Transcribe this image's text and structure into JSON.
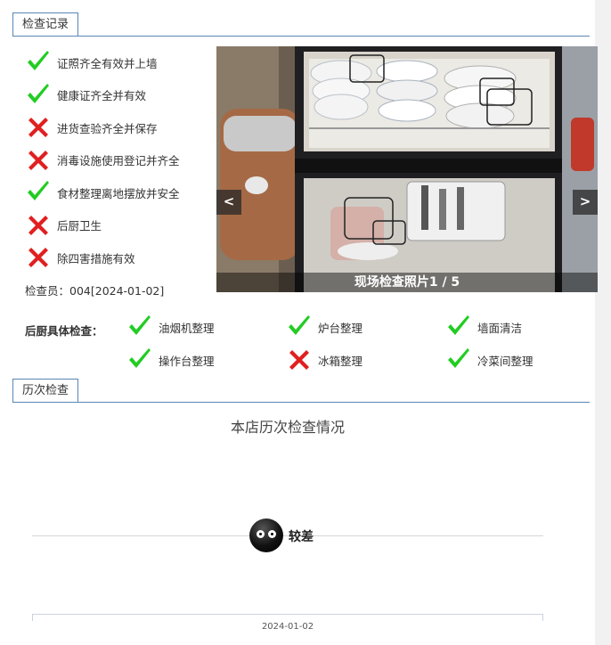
{
  "sections": {
    "inspection_record": "检查记录",
    "history": "历次检查"
  },
  "checks": [
    {
      "label": "证照齐全有效并上墙",
      "status": "pass"
    },
    {
      "label": "健康证齐全并有效",
      "status": "pass"
    },
    {
      "label": "进货查验齐全并保存",
      "status": "fail"
    },
    {
      "label": "消毒设施使用登记并齐全",
      "status": "fail"
    },
    {
      "label": "食材整理离地摆放并安全",
      "status": "pass"
    },
    {
      "label": "后厨卫生",
      "status": "fail"
    },
    {
      "label": "除四害措施有效",
      "status": "fail"
    }
  ],
  "inspector": "检查员：004[2024-01-02]",
  "photo": {
    "caption": "现场检查照片1 / 5",
    "prev": "<",
    "next": ">"
  },
  "kitchen": {
    "label": "后厨具体检查：",
    "items": [
      {
        "label": "油烟机整理",
        "status": "pass"
      },
      {
        "label": "炉台整理",
        "status": "pass"
      },
      {
        "label": "墙面清洁",
        "status": "pass"
      },
      {
        "label": "操作台整理",
        "status": "pass"
      },
      {
        "label": "冰箱整理",
        "status": "fail"
      },
      {
        "label": "冷菜间整理",
        "status": "pass"
      }
    ]
  },
  "history": {
    "title": "本店历次检查情况",
    "level": "较差",
    "date": "2024-01-02"
  },
  "colors": {
    "pass": "#22cc22",
    "fail": "#e02020",
    "accent": "#5a86b6"
  }
}
